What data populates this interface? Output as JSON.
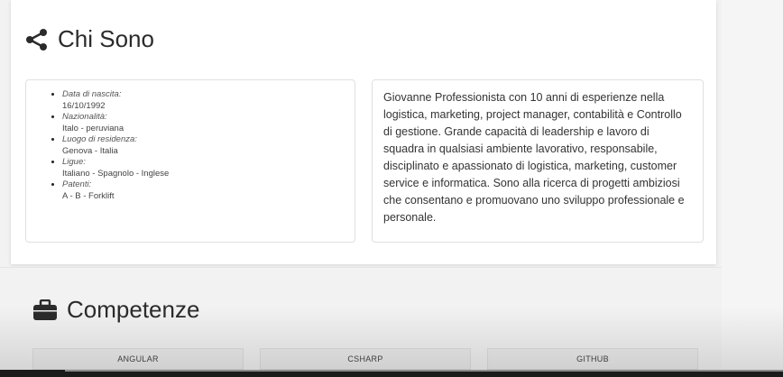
{
  "about": {
    "title": "Chi Sono",
    "icon": "share-icon",
    "details": [
      {
        "label": "Data di nascita:",
        "value": "16/10/1992"
      },
      {
        "label": "Nazionalità:",
        "value": "Italo - peruviana"
      },
      {
        "label": "Luogo di residenza:",
        "value": "Genova - Italia"
      },
      {
        "label": "Ligue:",
        "value": "Italiano - Spagnolo - Inglese"
      },
      {
        "label": "Patenti:",
        "value": "A - B - Forklift"
      }
    ],
    "bio": "Giovanne Professionista con 10 anni di esperienze nella logistica, marketing, project manager, contabilità e Controllo di gestione. Grande capacità di leadership e lavoro di squadra in qualsiasi ambiente lavorativo, responsabile, disciplinato e apassionato di logistica, marketing, customer service e informatica. Sono alla ricerca di progetti ambiziosi che consentano e promuovano uno sviluppo professionale e personale."
  },
  "skills": {
    "title": "Competenze",
    "icon": "briefcase-icon",
    "items": [
      "ANGULAR",
      "CSHARP",
      "GITHUB"
    ]
  },
  "colors": {
    "card": "#ffffff",
    "background": "#f2f2f2",
    "text": "#2b2b2b"
  }
}
